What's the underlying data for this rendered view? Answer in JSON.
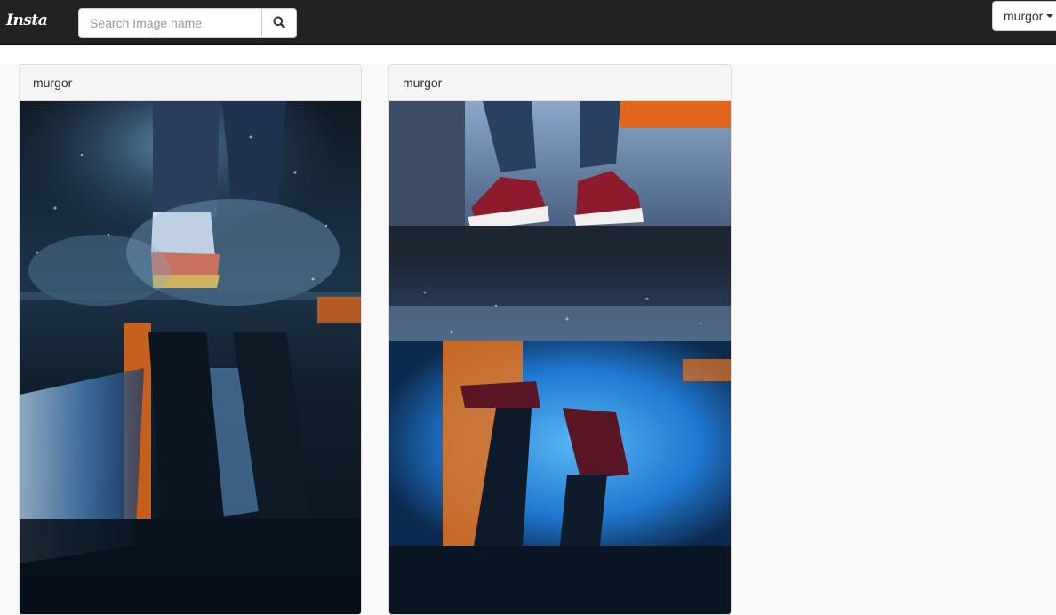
{
  "navbar": {
    "brand": "Insta",
    "search": {
      "placeholder": "Search Image name",
      "value": "",
      "icon": "search-icon"
    },
    "user_menu": {
      "label": "murgor",
      "icon": "caret-down-icon"
    }
  },
  "posts": [
    {
      "username": "murgor",
      "image": "splash-sneakers-puddle-reflection"
    },
    {
      "username": "murgor",
      "image": "red-sneakers-puddle-reflection"
    }
  ],
  "colors": {
    "navbar_bg": "#222222",
    "page_bg": "#f9f9f9",
    "card_header_bg": "#f5f5f5",
    "accent_orange": "#e86a1a",
    "accent_blue": "#2e8fe0"
  }
}
